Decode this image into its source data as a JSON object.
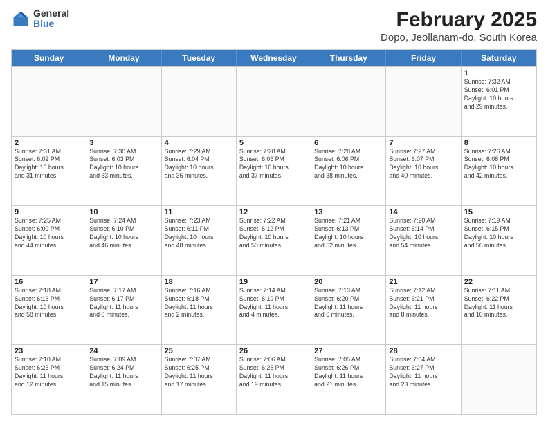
{
  "logo": {
    "general": "General",
    "blue": "Blue"
  },
  "title": "February 2025",
  "subtitle": "Dopo, Jeollanam-do, South Korea",
  "header_days": [
    "Sunday",
    "Monday",
    "Tuesday",
    "Wednesday",
    "Thursday",
    "Friday",
    "Saturday"
  ],
  "weeks": [
    [
      {
        "day": "",
        "info": ""
      },
      {
        "day": "",
        "info": ""
      },
      {
        "day": "",
        "info": ""
      },
      {
        "day": "",
        "info": ""
      },
      {
        "day": "",
        "info": ""
      },
      {
        "day": "",
        "info": ""
      },
      {
        "day": "1",
        "info": "Sunrise: 7:32 AM\nSunset: 6:01 PM\nDaylight: 10 hours\nand 29 minutes."
      }
    ],
    [
      {
        "day": "2",
        "info": "Sunrise: 7:31 AM\nSunset: 6:02 PM\nDaylight: 10 hours\nand 31 minutes."
      },
      {
        "day": "3",
        "info": "Sunrise: 7:30 AM\nSunset: 6:03 PM\nDaylight: 10 hours\nand 33 minutes."
      },
      {
        "day": "4",
        "info": "Sunrise: 7:29 AM\nSunset: 6:04 PM\nDaylight: 10 hours\nand 35 minutes."
      },
      {
        "day": "5",
        "info": "Sunrise: 7:28 AM\nSunset: 6:05 PM\nDaylight: 10 hours\nand 37 minutes."
      },
      {
        "day": "6",
        "info": "Sunrise: 7:28 AM\nSunset: 6:06 PM\nDaylight: 10 hours\nand 38 minutes."
      },
      {
        "day": "7",
        "info": "Sunrise: 7:27 AM\nSunset: 6:07 PM\nDaylight: 10 hours\nand 40 minutes."
      },
      {
        "day": "8",
        "info": "Sunrise: 7:26 AM\nSunset: 6:08 PM\nDaylight: 10 hours\nand 42 minutes."
      }
    ],
    [
      {
        "day": "9",
        "info": "Sunrise: 7:25 AM\nSunset: 6:09 PM\nDaylight: 10 hours\nand 44 minutes."
      },
      {
        "day": "10",
        "info": "Sunrise: 7:24 AM\nSunset: 6:10 PM\nDaylight: 10 hours\nand 46 minutes."
      },
      {
        "day": "11",
        "info": "Sunrise: 7:23 AM\nSunset: 6:11 PM\nDaylight: 10 hours\nand 48 minutes."
      },
      {
        "day": "12",
        "info": "Sunrise: 7:22 AM\nSunset: 6:12 PM\nDaylight: 10 hours\nand 50 minutes."
      },
      {
        "day": "13",
        "info": "Sunrise: 7:21 AM\nSunset: 6:13 PM\nDaylight: 10 hours\nand 52 minutes."
      },
      {
        "day": "14",
        "info": "Sunrise: 7:20 AM\nSunset: 6:14 PM\nDaylight: 10 hours\nand 54 minutes."
      },
      {
        "day": "15",
        "info": "Sunrise: 7:19 AM\nSunset: 6:15 PM\nDaylight: 10 hours\nand 56 minutes."
      }
    ],
    [
      {
        "day": "16",
        "info": "Sunrise: 7:18 AM\nSunset: 6:16 PM\nDaylight: 10 hours\nand 58 minutes."
      },
      {
        "day": "17",
        "info": "Sunrise: 7:17 AM\nSunset: 6:17 PM\nDaylight: 11 hours\nand 0 minutes."
      },
      {
        "day": "18",
        "info": "Sunrise: 7:16 AM\nSunset: 6:18 PM\nDaylight: 11 hours\nand 2 minutes."
      },
      {
        "day": "19",
        "info": "Sunrise: 7:14 AM\nSunset: 6:19 PM\nDaylight: 11 hours\nand 4 minutes."
      },
      {
        "day": "20",
        "info": "Sunrise: 7:13 AM\nSunset: 6:20 PM\nDaylight: 11 hours\nand 6 minutes."
      },
      {
        "day": "21",
        "info": "Sunrise: 7:12 AM\nSunset: 6:21 PM\nDaylight: 11 hours\nand 8 minutes."
      },
      {
        "day": "22",
        "info": "Sunrise: 7:11 AM\nSunset: 6:22 PM\nDaylight: 11 hours\nand 10 minutes."
      }
    ],
    [
      {
        "day": "23",
        "info": "Sunrise: 7:10 AM\nSunset: 6:23 PM\nDaylight: 11 hours\nand 12 minutes."
      },
      {
        "day": "24",
        "info": "Sunrise: 7:09 AM\nSunset: 6:24 PM\nDaylight: 11 hours\nand 15 minutes."
      },
      {
        "day": "25",
        "info": "Sunrise: 7:07 AM\nSunset: 6:25 PM\nDaylight: 11 hours\nand 17 minutes."
      },
      {
        "day": "26",
        "info": "Sunrise: 7:06 AM\nSunset: 6:25 PM\nDaylight: 11 hours\nand 19 minutes."
      },
      {
        "day": "27",
        "info": "Sunrise: 7:05 AM\nSunset: 6:26 PM\nDaylight: 11 hours\nand 21 minutes."
      },
      {
        "day": "28",
        "info": "Sunrise: 7:04 AM\nSunset: 6:27 PM\nDaylight: 11 hours\nand 23 minutes."
      },
      {
        "day": "",
        "info": ""
      }
    ]
  ]
}
